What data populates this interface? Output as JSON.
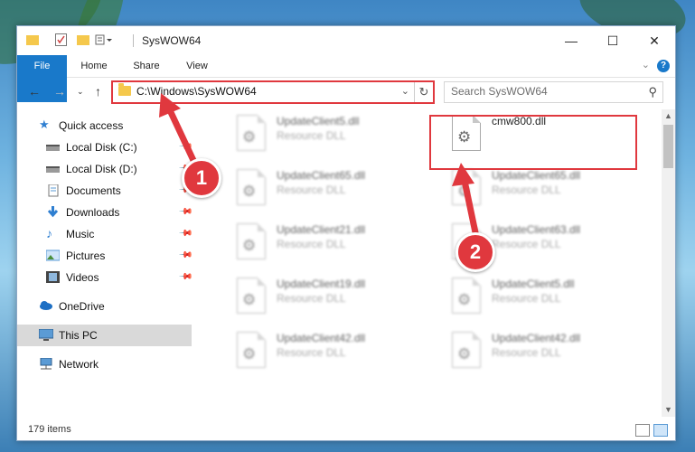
{
  "window": {
    "title": "SysWOW64"
  },
  "ribbon": {
    "tabs": [
      "File",
      "Home",
      "Share",
      "View"
    ],
    "help_label": "?"
  },
  "address": {
    "path": "C:\\Windows\\SysWOW64",
    "search_placeholder": "Search SysWOW64"
  },
  "nav": {
    "items": [
      {
        "label": "Quick access",
        "icon": "star-icon"
      },
      {
        "label": "Local Disk (C:)",
        "icon": "drive-icon",
        "pinned": true
      },
      {
        "label": "Local Disk (D:)",
        "icon": "drive-icon",
        "pinned": true
      },
      {
        "label": "Documents",
        "icon": "document-icon",
        "pinned": true
      },
      {
        "label": "Downloads",
        "icon": "download-icon",
        "pinned": true
      },
      {
        "label": "Music",
        "icon": "music-icon",
        "pinned": true
      },
      {
        "label": "Pictures",
        "icon": "pictures-icon",
        "pinned": true
      },
      {
        "label": "Videos",
        "icon": "video-icon",
        "pinned": true
      },
      {
        "label": "OneDrive",
        "icon": "cloud-icon"
      },
      {
        "label": "This PC",
        "icon": "computer-icon",
        "selected": true
      },
      {
        "label": "Network",
        "icon": "network-icon"
      }
    ]
  },
  "files": {
    "left": [
      {
        "name": "UpdateClient5.dll",
        "type": "Resource DLL"
      },
      {
        "name": "UpdateClient65.dll",
        "type": "Resource DLL"
      },
      {
        "name": "UpdateClient21.dll",
        "type": "Resource DLL"
      },
      {
        "name": "UpdateClient19.dll",
        "type": "Resource DLL"
      },
      {
        "name": "UpdateClient42.dll",
        "type": "Resource DLL"
      }
    ],
    "right": [
      {
        "name": "cmw800.dll",
        "type": ""
      },
      {
        "name": "UpdateClient65.dll",
        "type": "Resource DLL"
      },
      {
        "name": "UpdateClient63.dll",
        "type": "Resource DLL"
      },
      {
        "name": "UpdateClient5.dll",
        "type": "Resource DLL"
      },
      {
        "name": "UpdateClient42.dll",
        "type": "Resource DLL"
      }
    ]
  },
  "status": {
    "item_count": "179 items"
  },
  "annotations": {
    "step1": "1",
    "step2": "2",
    "color": "#e0383e"
  }
}
